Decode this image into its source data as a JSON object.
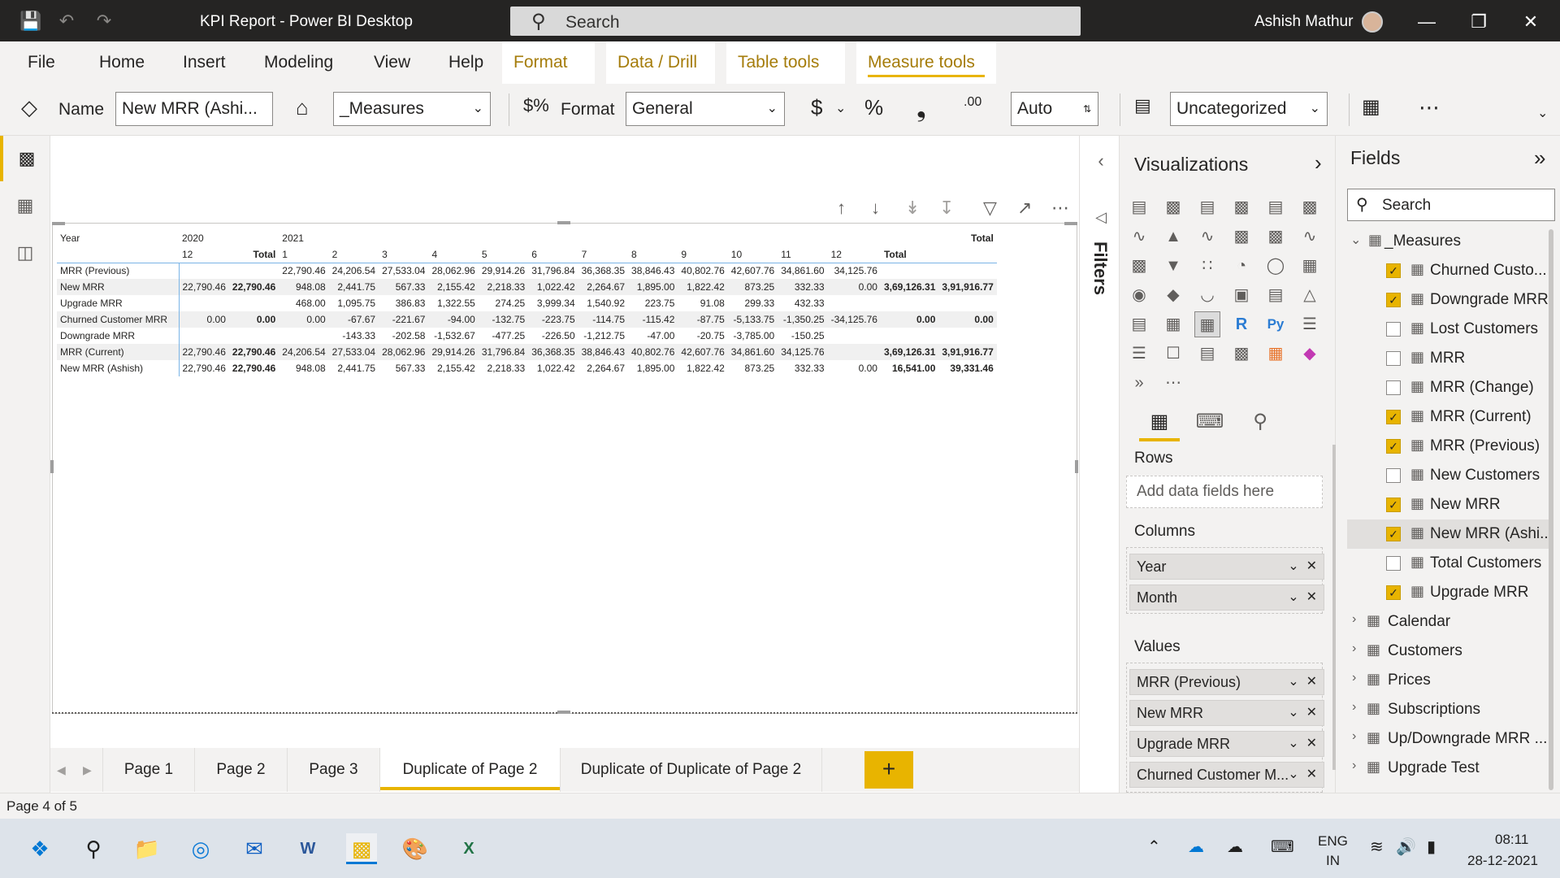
{
  "titlebar": {
    "title": "KPI Report - Power BI Desktop",
    "search_placeholder": "Search",
    "user_name": "Ashish Mathur"
  },
  "menu": {
    "items": [
      "File",
      "Home",
      "Insert",
      "Modeling",
      "View",
      "Help",
      "Format",
      "Data / Drill",
      "Table tools",
      "Measure tools"
    ],
    "active": "Measure tools"
  },
  "ribbon": {
    "name_label": "Name",
    "name_value": "New MRR (Ashi...",
    "home_table": "_Measures",
    "format_label": "Format",
    "format_value": "General",
    "currency_symbol": "$",
    "percent_symbol": "%",
    "comma_symbol": "❟",
    "decimal_symbol": ".00",
    "decimal_value": "Auto",
    "category_value": "Uncategorized"
  },
  "matrix": {
    "year_label": "Year",
    "years": [
      "2020",
      "2021"
    ],
    "total_label": "Total",
    "month_header": [
      "12",
      "Total",
      "1",
      "2",
      "3",
      "4",
      "5",
      "6",
      "7",
      "8",
      "9",
      "10",
      "11",
      "12",
      "Total",
      ""
    ],
    "rows": [
      {
        "label": "MRR (Previous)",
        "cells": [
          "",
          "",
          "22,790.46",
          "24,206.54",
          "27,533.04",
          "28,062.96",
          "29,914.26",
          "31,796.84",
          "36,368.35",
          "38,846.43",
          "40,802.76",
          "42,607.76",
          "34,861.60",
          "34,125.76",
          "",
          ""
        ]
      },
      {
        "label": "New MRR",
        "cells": [
          "22,790.46",
          "22,790.46",
          "948.08",
          "2,441.75",
          "567.33",
          "2,155.42",
          "2,218.33",
          "1,022.42",
          "2,264.67",
          "1,895.00",
          "1,822.42",
          "873.25",
          "332.33",
          "0.00",
          "3,69,126.31",
          "3,91,916.77"
        ]
      },
      {
        "label": "Upgrade MRR",
        "cells": [
          "",
          "",
          "468.00",
          "1,095.75",
          "386.83",
          "1,322.55",
          "274.25",
          "3,999.34",
          "1,540.92",
          "223.75",
          "91.08",
          "299.33",
          "432.33",
          "",
          "",
          ""
        ]
      },
      {
        "label": "Churned Customer MRR",
        "cells": [
          "0.00",
          "0.00",
          "0.00",
          "-67.67",
          "-221.67",
          "-94.00",
          "-132.75",
          "-223.75",
          "-114.75",
          "-115.42",
          "-87.75",
          "-5,133.75",
          "-1,350.25",
          "-34,125.76",
          "0.00",
          "0.00"
        ]
      },
      {
        "label": "Downgrade MRR",
        "cells": [
          "",
          "",
          "",
          "-143.33",
          "-202.58",
          "-1,532.67",
          "-477.25",
          "-226.50",
          "-1,212.75",
          "-47.00",
          "-20.75",
          "-3,785.00",
          "-150.25",
          "",
          "",
          ""
        ]
      },
      {
        "label": "MRR (Current)",
        "cells": [
          "22,790.46",
          "22,790.46",
          "24,206.54",
          "27,533.04",
          "28,062.96",
          "29,914.26",
          "31,796.84",
          "36,368.35",
          "38,846.43",
          "40,802.76",
          "42,607.76",
          "34,861.60",
          "34,125.76",
          "",
          "3,69,126.31",
          "3,91,916.77"
        ]
      },
      {
        "label": "New MRR (Ashish)",
        "cells": [
          "22,790.46",
          "22,790.46",
          "948.08",
          "2,441.75",
          "567.33",
          "2,155.42",
          "2,218.33",
          "1,022.42",
          "2,264.67",
          "1,895.00",
          "1,822.42",
          "873.25",
          "332.33",
          "0.00",
          "16,541.00",
          "39,331.46"
        ]
      }
    ]
  },
  "pages": {
    "tabs": [
      "Page 1",
      "Page 2",
      "Page 3",
      "Duplicate of Page 2",
      "Duplicate of Duplicate of Page 2"
    ],
    "active": "Duplicate of Page 2",
    "add_label": "+",
    "status": "Page 4 of 5"
  },
  "filters_label": "Filters",
  "visualizations": {
    "title": "Visualizations",
    "rows_label": "Rows",
    "rows_placeholder": "Add data fields here",
    "columns_label": "Columns",
    "columns": [
      "Year",
      "Month"
    ],
    "values_label": "Values",
    "values": [
      "MRR (Previous)",
      "New MRR",
      "Upgrade MRR",
      "Churned Customer M..."
    ]
  },
  "fields": {
    "title": "Fields",
    "search_placeholder": "Search",
    "measures_table": "_Measures",
    "measures": [
      {
        "name": "Churned Custo...",
        "checked": true
      },
      {
        "name": "Downgrade MRR",
        "checked": true
      },
      {
        "name": "Lost Customers",
        "checked": false
      },
      {
        "name": "MRR",
        "checked": false
      },
      {
        "name": "MRR (Change)",
        "checked": false
      },
      {
        "name": "MRR (Current)",
        "checked": true
      },
      {
        "name": "MRR (Previous)",
        "checked": true
      },
      {
        "name": "New Customers",
        "checked": false
      },
      {
        "name": "New MRR",
        "checked": true
      },
      {
        "name": "New MRR (Ashi...",
        "checked": true
      },
      {
        "name": "Total Customers",
        "checked": false
      },
      {
        "name": "Upgrade MRR",
        "checked": true
      }
    ],
    "tables": [
      "Calendar",
      "Customers",
      "Prices",
      "Subscriptions",
      "Up/Downgrade MRR ...",
      "Upgrade Test"
    ]
  },
  "taskbar": {
    "lang_top": "ENG",
    "lang_bottom": "IN",
    "time": "08:11",
    "date": "28-12-2021"
  },
  "colors": {
    "accent": "#e8b400",
    "titlebar": "#252423",
    "ribbon": "#f3f2f1"
  }
}
